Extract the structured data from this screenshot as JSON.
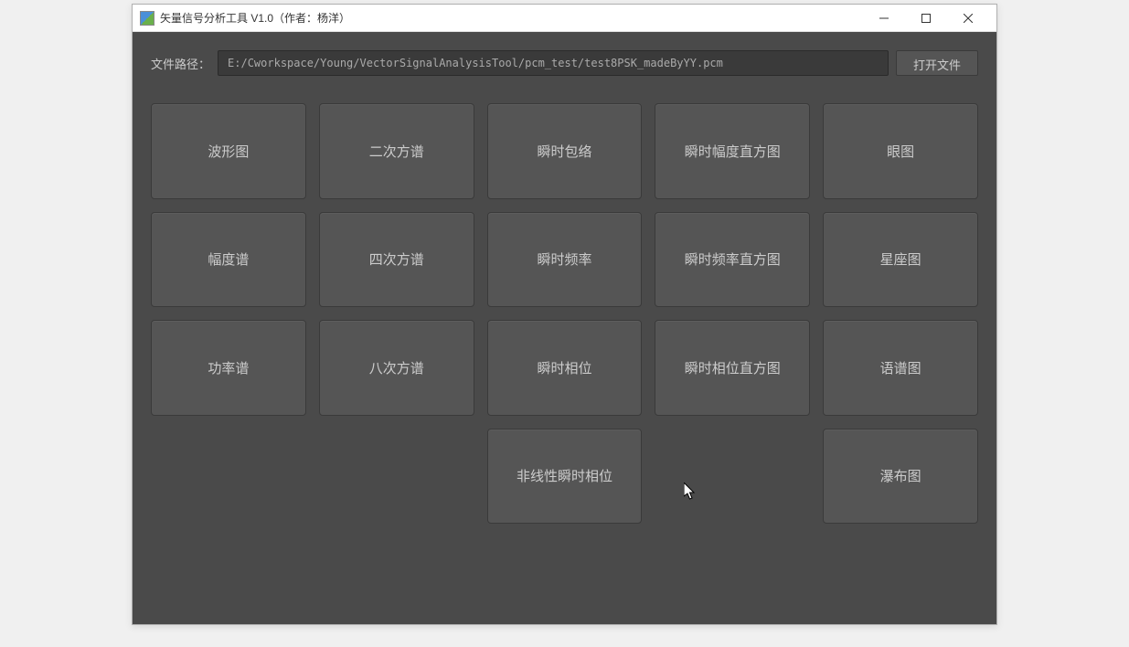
{
  "window": {
    "title": "矢量信号分析工具 V1.0（作者：杨洋）"
  },
  "fileRow": {
    "label": "文件路径：",
    "path": "E:/Cworkspace/Young/VectorSignalAnalysisTool/pcm_test/test8PSK_madeByYY.pcm",
    "openButton": "打开文件"
  },
  "buttons": {
    "r0c0": "波形图",
    "r0c1": "二次方谱",
    "r0c2": "瞬时包络",
    "r0c3": "瞬时幅度直方图",
    "r0c4": "眼图",
    "r1c0": "幅度谱",
    "r1c1": "四次方谱",
    "r1c2": "瞬时频率",
    "r1c3": "瞬时频率直方图",
    "r1c4": "星座图",
    "r2c0": "功率谱",
    "r2c1": "八次方谱",
    "r2c2": "瞬时相位",
    "r2c3": "瞬时相位直方图",
    "r2c4": "语谱图",
    "r3c2": "非线性瞬时相位",
    "r3c4": "瀑布图"
  }
}
